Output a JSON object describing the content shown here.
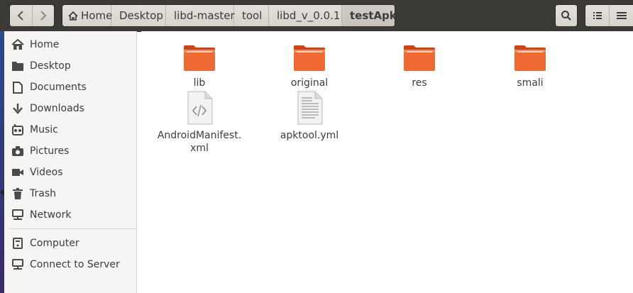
{
  "window": {
    "nav": {
      "back_icon": "chevron-left-icon",
      "forward_icon": "chevron-right-icon"
    },
    "breadcrumbs": [
      {
        "label": "Home",
        "icon": "home-icon"
      },
      {
        "label": "Desktop"
      },
      {
        "label": "libd-master"
      },
      {
        "label": "tool"
      },
      {
        "label": "libd_v_0.0.1"
      },
      {
        "label": "testApk",
        "current": true
      }
    ],
    "toolbar": {
      "search_icon": "search-icon",
      "list_view_icon": "list-view-icon",
      "menu_icon": "menu-icon"
    }
  },
  "sidebar": {
    "items": [
      {
        "label": "Home",
        "icon": "home-icon"
      },
      {
        "label": "Desktop",
        "icon": "desktop-folder-icon"
      },
      {
        "label": "Documents",
        "icon": "documents-icon"
      },
      {
        "label": "Downloads",
        "icon": "downloads-icon"
      },
      {
        "label": "Music",
        "icon": "music-icon"
      },
      {
        "label": "Pictures",
        "icon": "camera-icon"
      },
      {
        "label": "Videos",
        "icon": "video-icon"
      },
      {
        "label": "Trash",
        "icon": "trash-icon"
      },
      {
        "label": "Network",
        "icon": "network-icon"
      },
      {
        "label": "Computer",
        "icon": "computer-icon"
      },
      {
        "label": "Connect to Server",
        "icon": "server-icon"
      }
    ]
  },
  "files": [
    {
      "name": "lib",
      "type": "folder"
    },
    {
      "name": "original",
      "type": "folder"
    },
    {
      "name": "res",
      "type": "folder"
    },
    {
      "name": "smali",
      "type": "folder"
    },
    {
      "name": "AndroidManifest.\nxml",
      "type": "xml"
    },
    {
      "name": "apktool.yml",
      "type": "text"
    }
  ],
  "colors": {
    "folder_accent": "#e95420",
    "header_bg": "#3b3a37"
  }
}
